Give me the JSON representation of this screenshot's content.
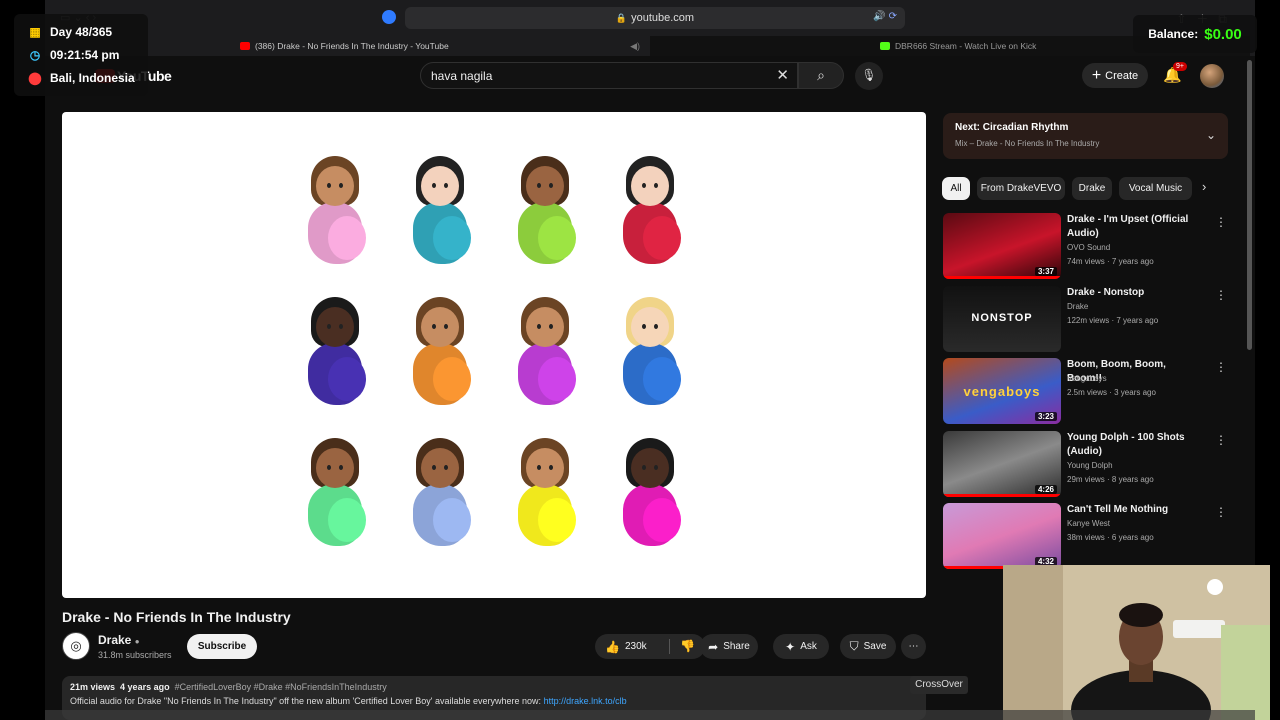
{
  "browser": {
    "url": "youtube.com",
    "tabs": [
      {
        "label": "(386) Drake - No Friends In The Industry - YouTube",
        "favicon_color": "#ff0000"
      },
      {
        "label": "DBR666 Stream - Watch Live on Kick",
        "favicon_color": "#53fc18"
      }
    ]
  },
  "overlay": {
    "day": "Day 48/365",
    "time": "09:21:54 pm",
    "location": "Bali, Indonesia",
    "balance_label": "Balance:",
    "balance_value": "$0.00",
    "crossover": "CrossOver"
  },
  "youtube": {
    "logo": "YouTube",
    "search": {
      "value": "hava nagila"
    },
    "create_label": "Create",
    "notifications": "9+"
  },
  "video": {
    "title": "Drake - No Friends In The Industry",
    "channel": "Drake",
    "subscribers": "31.8m subscribers",
    "subscribe_label": "Subscribe",
    "likes": "230k",
    "share_label": "Share",
    "ask_label": "Ask",
    "save_label": "Save",
    "views": "21m views",
    "age": "4 years ago",
    "hashtags": "#CertifiedLoverBoy #Drake #NoFriendsInTheIndustry",
    "description": "Official audio for Drake \"No Friends In The Industry\" off the new album 'Certified Lover Boy' available everywhere now:",
    "link": "http://drake.lnk.to/clb",
    "emoji_rows": [
      [
        {
          "skin": "#c68d62",
          "hair": "#6b4424",
          "shirt": "#e09ac8"
        },
        {
          "skin": "#f3d2bd",
          "hair": "#222222",
          "shirt": "#2fa0b4"
        },
        {
          "skin": "#9a6441",
          "hair": "#4a2e1a",
          "shirt": "#8ccc3c"
        },
        {
          "skin": "#f3d2bd",
          "hair": "#222222",
          "shirt": "#c8203c"
        }
      ],
      [
        {
          "skin": "#4a2e22",
          "hair": "#1a1a1a",
          "shirt": "#402ca0"
        },
        {
          "skin": "#c68d62",
          "hair": "#6b4424",
          "shirt": "#e0862c"
        },
        {
          "skin": "#c68d62",
          "hair": "#6b4424",
          "shirt": "#b83cd0"
        },
        {
          "skin": "#f6d6b8",
          "hair": "#f0d488",
          "shirt": "#2c6cc8"
        }
      ],
      [
        {
          "skin": "#9a6441",
          "hair": "#4a2e1a",
          "shirt": "#5cdc8c"
        },
        {
          "skin": "#9a6441",
          "hair": "#4a2e1a",
          "shirt": "#8ca4d8"
        },
        {
          "skin": "#c68d62",
          "hair": "#6b4424",
          "shirt": "#f0e81c"
        },
        {
          "skin": "#4a2e22",
          "hair": "#1a1a1a",
          "shirt": "#e01cb4"
        }
      ]
    ]
  },
  "sidebar": {
    "up_next_title": "Next: Circadian Rhythm",
    "up_next_subtitle": "Mix – Drake - No Friends In The Industry",
    "chips": [
      "All",
      "From DrakeVEVO",
      "Drake",
      "Vocal Music"
    ],
    "recommendations": [
      {
        "title": "Drake - I'm Upset (Official Audio)",
        "channel": "OVO Sound",
        "stats": "74m views · 7 years ago",
        "duration": "3:37",
        "thumb": "linear-gradient(160deg,#5a0a12,#c8142a 55%,#2a0508)",
        "progress": 1.0
      },
      {
        "title": "Drake - Nonstop",
        "channel": "Drake",
        "stats": "122m views · 7 years ago",
        "duration": "",
        "thumb": "linear-gradient(180deg,#111,#2a2a2a)",
        "thumb_text": "NONSTOP",
        "progress": 0
      },
      {
        "title": "Boom, Boom, Boom, Boom!!",
        "channel": "Vengaboys",
        "stats": "2.5m views · 3 years ago",
        "duration": "3:23",
        "thumb": "linear-gradient(160deg,#b44a1c,#3a5cc8 60%,#8a2ca0)",
        "thumb_text": "vengaboys",
        "progress": 0
      },
      {
        "title": "Young Dolph - 100 Shots (Audio)",
        "channel": "Young Dolph",
        "stats": "29m views · 8 years ago",
        "duration": "4:26",
        "thumb": "linear-gradient(160deg,#3a3a3a,#8a8a8a 50%,#2a2a2a)",
        "progress": 1.0
      },
      {
        "title": "Can't Tell Me Nothing",
        "channel": "Kanye West",
        "stats": "38m views · 6 years ago",
        "duration": "4:32",
        "thumb": "linear-gradient(160deg,#c89ad8,#e07ab4 50%,#7a4ca0)",
        "progress": 0.8
      }
    ]
  }
}
